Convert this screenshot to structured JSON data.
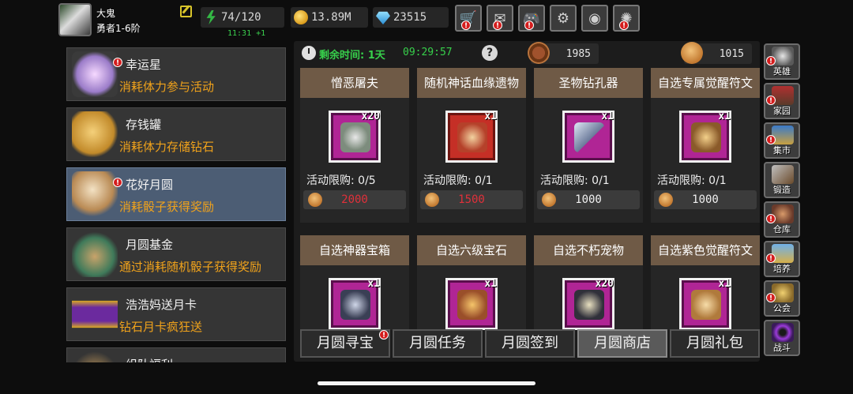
{
  "player": {
    "name": "大鬼",
    "rank": "勇者1-6阶",
    "energy": "74/120",
    "energy_regen": "11:31 +1",
    "gold": "13.89M",
    "gems": "23515"
  },
  "top_buttons": [
    {
      "icon": "cart-icon",
      "glyph": "🛒",
      "badge": "!"
    },
    {
      "icon": "mail-icon",
      "glyph": "✉",
      "badge": "!"
    },
    {
      "icon": "gamepad-icon",
      "glyph": "🎮",
      "badge": "!"
    },
    {
      "icon": "gear-icon",
      "glyph": "⚙",
      "badge": ""
    },
    {
      "icon": "color-wheel-icon",
      "glyph": "◉",
      "badge": ""
    },
    {
      "icon": "firework-icon",
      "glyph": "✺",
      "badge": "!"
    }
  ],
  "events": [
    {
      "title": "幸运星",
      "desc": "消耗体力参与活动",
      "badge": "!"
    },
    {
      "title": "存钱罐",
      "desc": "消耗体力存储钻石",
      "badge": ""
    },
    {
      "title": "花好月圆",
      "desc": "消耗骰子获得奖励",
      "badge": "!"
    },
    {
      "title": "月圆基金",
      "desc": "通过消耗随机骰子获得奖励",
      "badge": ""
    },
    {
      "title": "浩浩妈送月卡",
      "desc": "钻石月卡疯狂送",
      "badge": ""
    },
    {
      "title": "组队福利",
      "desc": "",
      "badge": ""
    }
  ],
  "shop": {
    "timer_label": "剩余时间: 1天",
    "timer_value": "09:29:57",
    "help_glyph": "?",
    "currency_1": "1985",
    "currency_2": "1015",
    "items": [
      {
        "name": "憎恶屠夫",
        "qty": "x20",
        "limit": "活动限购: 0/5",
        "price": "2000",
        "price_color": "#e0303a"
      },
      {
        "name": "随机神话血缘遗物",
        "qty": "x1",
        "limit": "活动限购: 0/1",
        "price": "1500",
        "price_color": "#e0303a"
      },
      {
        "name": "圣物钻孔器",
        "qty": "x1",
        "limit": "活动限购: 0/1",
        "price": "1000",
        "price_color": "#f0f0f0"
      },
      {
        "name": "自选专属觉醒符文",
        "qty": "x1",
        "limit": "活动限购: 0/1",
        "price": "1000",
        "price_color": "#f0f0f0"
      },
      {
        "name": "自选神器宝箱",
        "qty": "x1",
        "limit": "",
        "price": "",
        "price_color": "#f0f0f0"
      },
      {
        "name": "自选六级宝石",
        "qty": "x1",
        "limit": "",
        "price": "",
        "price_color": "#f0f0f0"
      },
      {
        "name": "自选不朽宠物",
        "qty": "x20",
        "limit": "",
        "price": "",
        "price_color": "#f0f0f0"
      },
      {
        "name": "自选紫色觉醒符文",
        "qty": "x1",
        "limit": "",
        "price": "",
        "price_color": "#f0f0f0"
      }
    ]
  },
  "tabs": [
    {
      "label": "月圆寻宝",
      "badge": "!"
    },
    {
      "label": "月圆任务",
      "badge": ""
    },
    {
      "label": "月圆签到",
      "badge": ""
    },
    {
      "label": "月圆商店",
      "badge": ""
    },
    {
      "label": "月圆礼包",
      "badge": ""
    }
  ],
  "sidebar": [
    {
      "label": "英雄",
      "badge": "!"
    },
    {
      "label": "家园",
      "badge": "!"
    },
    {
      "label": "集市",
      "badge": "!"
    },
    {
      "label": "锻造",
      "badge": ""
    },
    {
      "label": "仓库",
      "badge": "!"
    },
    {
      "label": "培养",
      "badge": "!"
    },
    {
      "label": "公会",
      "badge": "!"
    },
    {
      "label": "战斗",
      "badge": ""
    }
  ],
  "colors": {
    "accent_green": "#37d04b",
    "event_desc": "#f0a21b",
    "badge_red": "#d41d1d",
    "card_header": "#6f5a46"
  }
}
